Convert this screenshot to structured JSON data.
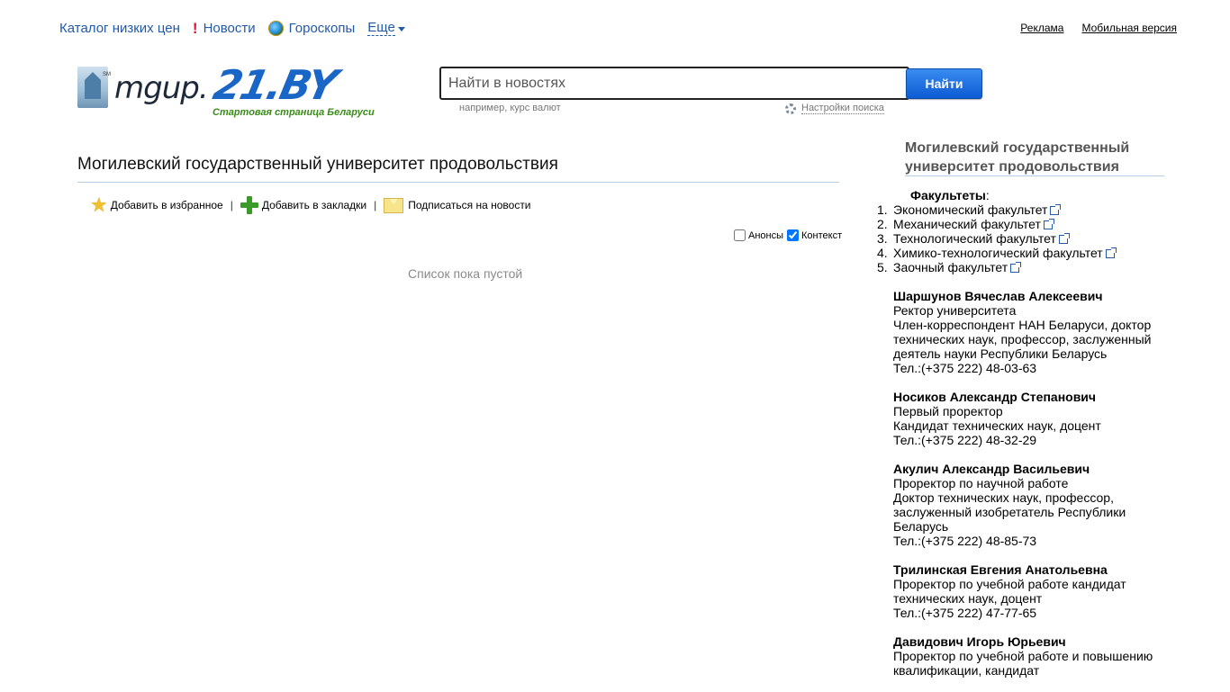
{
  "topnav": {
    "catalog": "Каталог низких цен",
    "news": "Новости",
    "horoscopes": "Гороскопы",
    "more": "Еще"
  },
  "toplinks": {
    "ads": "Реклама",
    "mobile": "Мобильная версия"
  },
  "logo": {
    "mgup_text": "mgup.",
    "site": "21.BY",
    "tagline": "Стартовая страница Беларуси"
  },
  "search": {
    "placeholder": "Найти в новостях",
    "button": "Найти",
    "hint": "например, курс валют",
    "settings": "Настройки поиска"
  },
  "main": {
    "title": "Могилевский государственный университет продовольствия",
    "actions": {
      "favorites": "Добавить в избранное",
      "bookmarks": "Добавить в закладки",
      "subscribe": "Подписаться на новости",
      "separator": "|"
    },
    "filters": {
      "announcements": "Анонсы",
      "announcements_checked": false,
      "context": "Контекст",
      "context_checked": true
    },
    "empty": "Список пока пустой"
  },
  "sidebar": {
    "title": "Могилевский государственный университет продовольствия",
    "faculties_label": "Факультеты",
    "faculties": [
      "Экономический факультет",
      "Механический факультет",
      "Технологический факультет",
      "Химико-технологический факультет",
      "Заочный факультет"
    ],
    "persons": [
      {
        "name": "Шаршунов Вячеслав Алексеевич",
        "lines": [
          "Ректор университета",
          "Член-корреспондент НАН Беларуси, доктор технических наук, профессор, заслуженный деятель науки Республики Беларусь",
          "Тел.:(+375 222) 48-03-63"
        ]
      },
      {
        "name": "Носиков Александр Степанович",
        "lines": [
          "Первый проректор",
          "Кандидат технических наук, доцент",
          "Тел.:(+375 222) 48-32-29"
        ]
      },
      {
        "name": "Акулич Александр Васильевич",
        "lines": [
          "Проректор по научной работе",
          "Доктор технических наук, профессор, заслуженный изобретатель Республики Беларусь",
          "Тел.:(+375 222) 48-85-73"
        ]
      },
      {
        "name": "Трилинская Евгения Анатольевна",
        "lines": [
          "Проректор по учебной работе кандидат технических наук, доцент",
          "Тел.:(+375 222) 47-77-65"
        ]
      },
      {
        "name": "Давидович Игорь Юрьевич",
        "lines": [
          "Проректор по учебной работе и повышению квалификации, кандидат"
        ]
      }
    ]
  }
}
